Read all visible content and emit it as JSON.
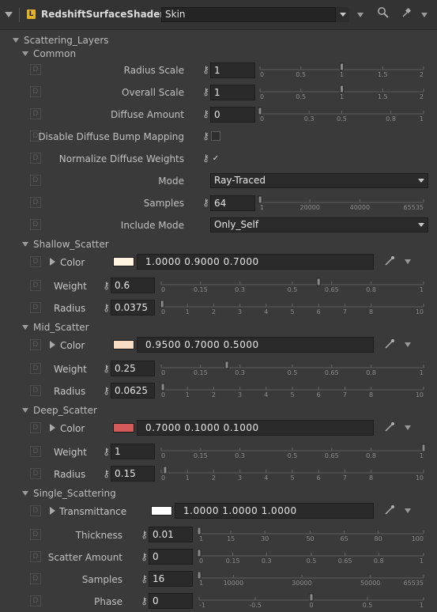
{
  "header": {
    "node_badge": "L",
    "node_type": "RedshiftSurfaceShader",
    "node_name": "Skin"
  },
  "sections": {
    "scattering_layers": "Scattering_Layers",
    "common": "Common",
    "shallow": "Shallow_Scatter",
    "mid": "Mid_Scatter",
    "deep": "Deep_Scatter",
    "single": "Single_Scattering"
  },
  "common": {
    "radius_scale": {
      "label": "Radius Scale",
      "value": "1",
      "ticks": [
        "0",
        "0.5",
        "1",
        "1.5",
        "2"
      ]
    },
    "overall_scale": {
      "label": "Overall Scale",
      "value": "1",
      "ticks": [
        "0",
        "0.5",
        "1",
        "1.5",
        "2"
      ]
    },
    "diffuse_amount": {
      "label": "Diffuse Amount",
      "value": "0",
      "ticks": [
        "0",
        "0.3",
        "0.5",
        "0.8",
        "1"
      ]
    },
    "disable_bump": {
      "label": "Disable Diffuse Bump Mapping",
      "checked": false
    },
    "normalize": {
      "label": "Normalize Diffuse Weights",
      "checked": true,
      "mark": "✓"
    },
    "mode": {
      "label": "Mode",
      "value": "Ray-Traced"
    },
    "samples": {
      "label": "Samples",
      "value": "64",
      "ticks": [
        "1",
        "20000",
        "40000",
        "65535"
      ]
    },
    "include_mode": {
      "label": "Include Mode",
      "value": "Only_Self"
    }
  },
  "shallow": {
    "color_label": "Color",
    "color_value": "1.0000   0.9000   0.7000",
    "swatch": "#fff4e0",
    "weight_label": "Weight",
    "weight_value": "0.6",
    "radius_label": "Radius",
    "radius_value": "0.0375"
  },
  "mid": {
    "color_label": "Color",
    "color_value": "0.9500   0.7000   0.5000",
    "swatch": "#f6dcc2",
    "weight_label": "Weight",
    "weight_value": "0.25",
    "radius_label": "Radius",
    "radius_value": "0.0625"
  },
  "deep": {
    "color_label": "Color",
    "color_value": "0.7000   0.1000   0.1000",
    "swatch": "#d65a5a",
    "weight_label": "Weight",
    "weight_value": "1",
    "radius_label": "Radius",
    "radius_value": "0.15"
  },
  "single": {
    "transmittance_label": "Transmittance",
    "transmittance_value": "1.0000   1.0000   1.0000",
    "swatch": "#ffffff",
    "thickness": {
      "label": "Thickness",
      "value": "0.01",
      "ticks": [
        "1",
        "15",
        "30",
        "50",
        "65",
        "80",
        "100"
      ]
    },
    "scatter_amount": {
      "label": "Scatter Amount",
      "value": "0",
      "ticks": [
        "0",
        "0.15",
        "0.3",
        "0.5",
        "0.65",
        "0.8",
        "1"
      ]
    },
    "samples": {
      "label": "Samples",
      "value": "16",
      "ticks": [
        "1",
        "10000",
        "30000",
        "50000",
        "65535"
      ]
    },
    "phase": {
      "label": "Phase",
      "value": "0",
      "ticks": [
        "-1",
        "-0.5",
        "0",
        "0.5",
        "1"
      ]
    }
  },
  "weight_ticks": [
    "0",
    "0.15",
    "0.3",
    "0.5",
    "0.65",
    "0.8",
    "1"
  ],
  "radius_ticks": [
    "0",
    "1",
    "2",
    "3",
    "4",
    "5",
    "6",
    "7",
    "8",
    "10"
  ],
  "key_glyph": "⚷",
  "dbox_glyph": "D",
  "slider_levels": {
    "radius_scale": 1,
    "overall_scale": 1,
    "diffuse_amount": 0,
    "samples": 64,
    "shallow_weight": 0.6,
    "shallow_radius": 0.0375,
    "mid_weight": 0.25,
    "mid_radius": 0.0625,
    "deep_weight": 1,
    "deep_radius": 0.15,
    "thickness": 0.01,
    "scatter_amount": 0,
    "single_samples": 16,
    "phase": 0
  }
}
